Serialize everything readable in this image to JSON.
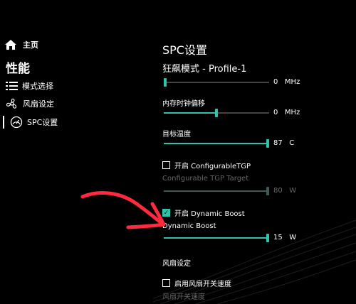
{
  "nav": {
    "home_label": "主页",
    "section_title": "性能",
    "items": [
      {
        "label": "模式选择",
        "icon": "list-icon"
      },
      {
        "label": "风扇设定",
        "icon": "fan-icon"
      },
      {
        "label": "SPC设置",
        "icon": "gauge-icon",
        "active": true
      }
    ]
  },
  "main": {
    "title": "SPC设置",
    "profile": "狂飙模式 - Profile-1",
    "sliders": [
      {
        "label": "",
        "value": "0",
        "unit": "MHz",
        "fraction": 0.0
      },
      {
        "label": "内存时钟偏移",
        "value": "0",
        "unit": "MHz",
        "fraction": 0.5
      },
      {
        "label": "目标温度",
        "value": "87",
        "unit": "C",
        "fraction": 1.0
      }
    ],
    "configurable_tgp": {
      "checkbox_label": "开启 ConfigurableTGP",
      "checked": false,
      "slider_label": "Configurable TGP Target",
      "value": "80",
      "unit": "W",
      "fraction": 1.0
    },
    "dynamic_boost": {
      "checkbox_label": "开启 Dynamic Boost",
      "checked": true,
      "slider_label": "Dynamic Boost",
      "value": "15",
      "unit": "W",
      "fraction": 1.0
    },
    "fan_section": {
      "title": "风扇设定",
      "checkbox_label": "启用风扇开关速度",
      "checked": false,
      "slider_label": "风扇开关速度"
    }
  },
  "colors": {
    "accent": "#2fc4aa",
    "annotation_arrow": "#ff2a3d"
  }
}
